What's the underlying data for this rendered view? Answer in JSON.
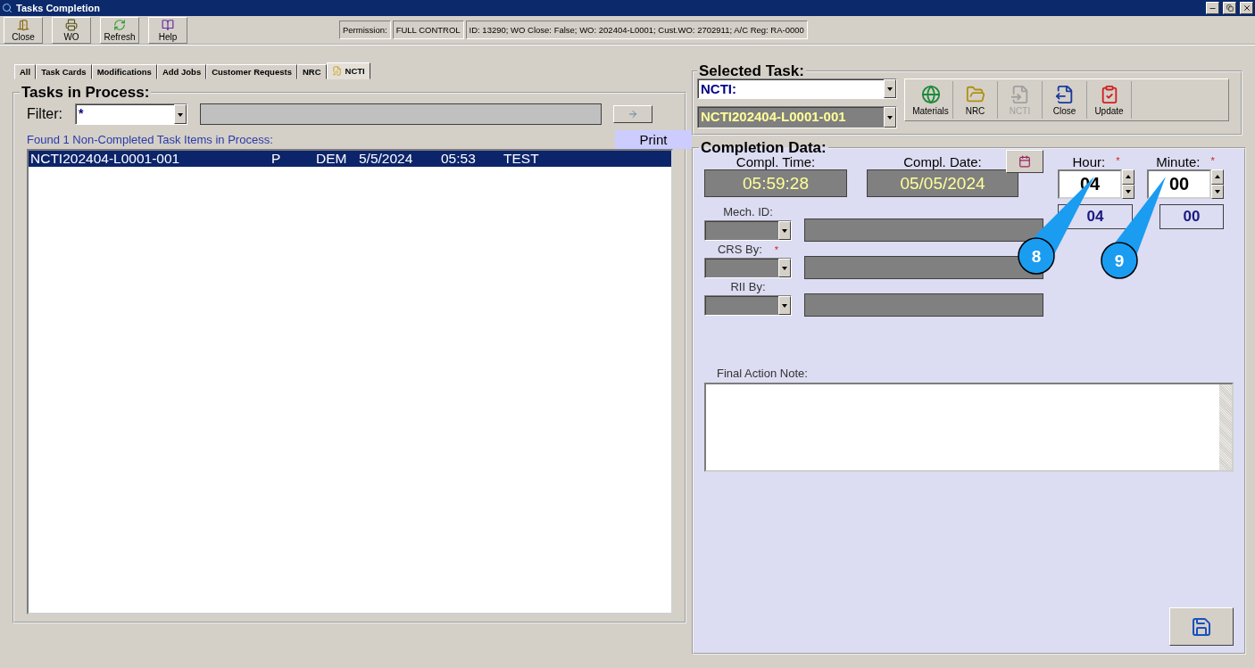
{
  "window": {
    "title": "Tasks Completion"
  },
  "toolbar": [
    {
      "label": "Close"
    },
    {
      "label": "WO"
    },
    {
      "label": "Refresh"
    },
    {
      "label": "Help"
    }
  ],
  "status": {
    "permission_label": "Permission:",
    "permission": "FULL CONTROL",
    "info": "ID: 13290; WO Close: False; WO: 202404-L0001; Cust.WO: 2702911; A/C Reg: RA-0000"
  },
  "tabs": [
    {
      "label": "All",
      "selected": false
    },
    {
      "label": "Task Cards",
      "selected": false
    },
    {
      "label": "Modifications",
      "selected": false
    },
    {
      "label": "Add Jobs",
      "selected": false
    },
    {
      "label": "Customer Requests",
      "selected": false
    },
    {
      "label": "NRC",
      "selected": false
    },
    {
      "label": "NCTI",
      "selected": true
    }
  ],
  "tasks_in_process": {
    "title": "Tasks in Process:",
    "filter": {
      "label": "Filter:",
      "value": "*"
    },
    "found_text": "Found 1 Non-Completed Task Items in Process:",
    "print_button": "Print",
    "rows": [
      {
        "cells": [
          "NCTI202404-L0001-001",
          "P",
          "DEM",
          "5/5/2024",
          "05:53",
          "TEST"
        ],
        "selected": true
      }
    ]
  },
  "selected_task": {
    "title": "Selected Task:",
    "type_value": "NCTI:",
    "task_value": "NCTI202404-L0001-001",
    "actions": [
      {
        "label": "Materials",
        "disabled": false
      },
      {
        "label": "NRC",
        "disabled": false
      },
      {
        "label": "NCTI",
        "disabled": true
      },
      {
        "label": "Close",
        "disabled": false
      },
      {
        "label": "Update",
        "disabled": false
      }
    ]
  },
  "completion_data": {
    "title": "Completion Data:",
    "compl_time": {
      "label": "Compl. Time:",
      "value": "05:59:28"
    },
    "compl_date": {
      "label": "Compl. Date:",
      "value": "05/05/2024"
    },
    "hour": {
      "label": "Hour:",
      "required_mark": "*",
      "value": "04",
      "display": "04"
    },
    "minute": {
      "label": "Minute:",
      "required_mark": "*",
      "value": "00",
      "display": "00"
    },
    "people": [
      {
        "label": "Mech. ID:"
      },
      {
        "label": "CRS By:",
        "required_mark": "*"
      },
      {
        "label": "RII By:"
      }
    ],
    "final_action_note": {
      "label": "Final Action Note:"
    }
  },
  "callouts": [
    {
      "label": "8"
    },
    {
      "label": "9"
    }
  ]
}
